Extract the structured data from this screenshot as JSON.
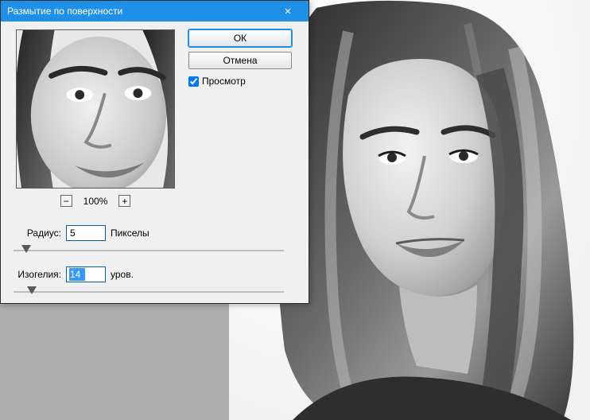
{
  "dialog": {
    "title": "Размытие по поверхности",
    "close_icon": "×",
    "ok_label": "ОК",
    "cancel_label": "Отмена",
    "preview_checkbox_label": "Просмотр",
    "preview_checked": true,
    "zoom": {
      "minus": "−",
      "plus": "+",
      "level": "100%"
    },
    "radius": {
      "label": "Радиус:",
      "value": "5",
      "unit": "Пикселы",
      "slider_pos_pct": 3
    },
    "threshold": {
      "label": "Изогелия:",
      "value": "14",
      "unit": "уров.",
      "slider_pos_pct": 5
    }
  }
}
